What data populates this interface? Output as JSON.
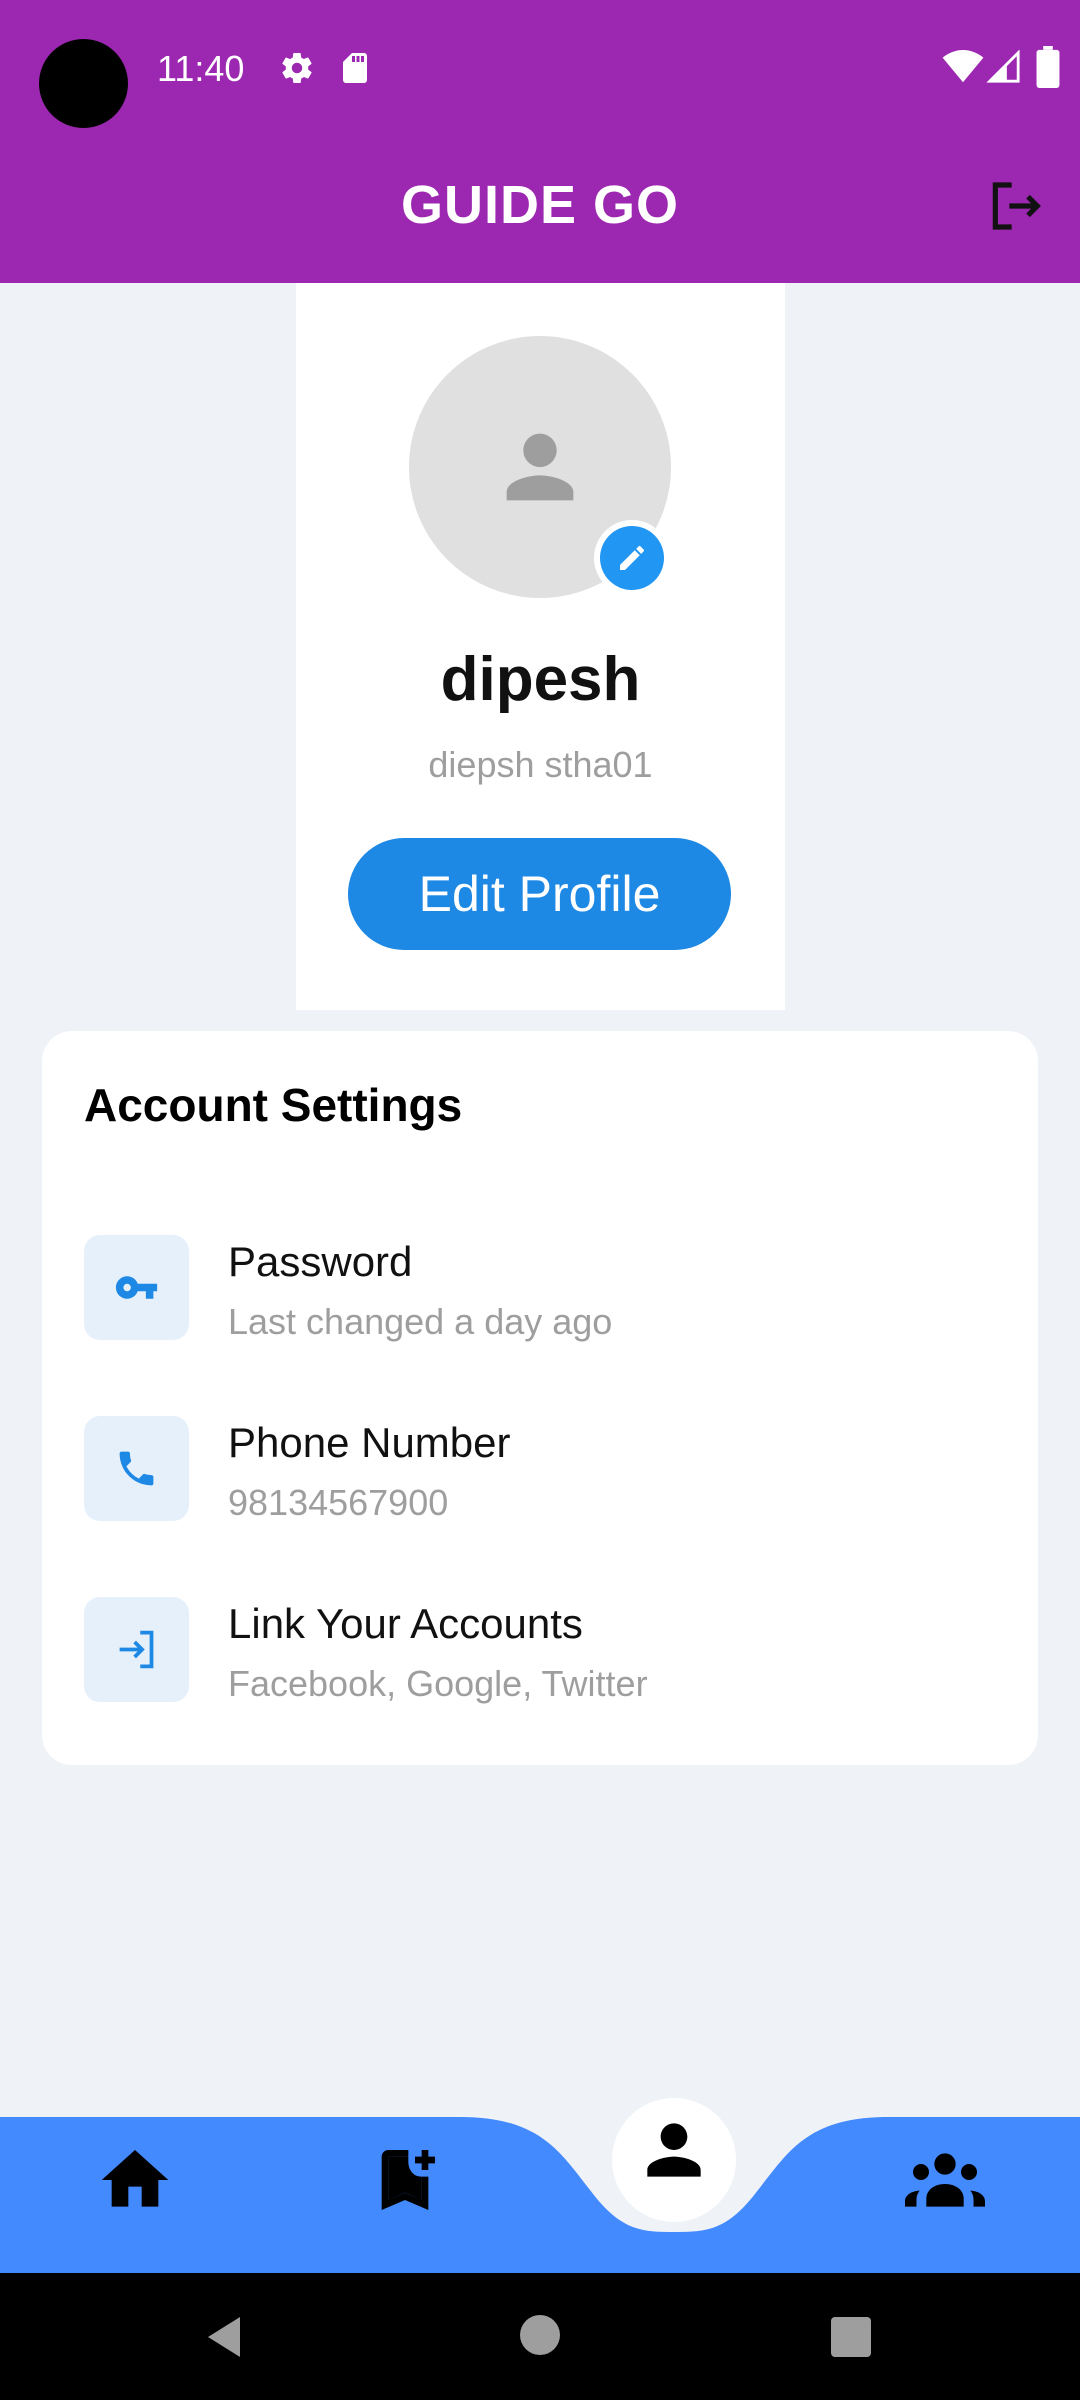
{
  "status_bar": {
    "time": "11:40",
    "icons": [
      "settings-icon",
      "sd-card-icon",
      "wifi-icon",
      "signal-icon",
      "battery-icon"
    ]
  },
  "app_bar": {
    "title": "GUIDE GO",
    "action_icon": "logout-icon"
  },
  "profile": {
    "name": "dipesh",
    "username": "diepsh stha01",
    "edit_button": "Edit Profile",
    "avatar_icon": "person-icon",
    "edit_avatar_icon": "pencil-icon"
  },
  "account_settings": {
    "title": "Account Settings",
    "items": [
      {
        "label": "Password",
        "subtitle": "Last changed a day ago",
        "icon": "key-icon"
      },
      {
        "label": "Phone Number",
        "subtitle": "98134567900",
        "icon": "phone-icon"
      },
      {
        "label": "Link Your Accounts",
        "subtitle": "Facebook, Google, Twitter",
        "icon": "login-arrow-icon"
      }
    ]
  },
  "bottom_nav": {
    "items": [
      "home-icon",
      "bookmark-add-icon",
      "person-icon",
      "groups-icon"
    ],
    "selected": "person-icon"
  },
  "colors": {
    "app_bar": "#9c27b0",
    "accent": "#1e88e5",
    "bottom_nav": "#448aff",
    "background": "#eff2f7"
  }
}
